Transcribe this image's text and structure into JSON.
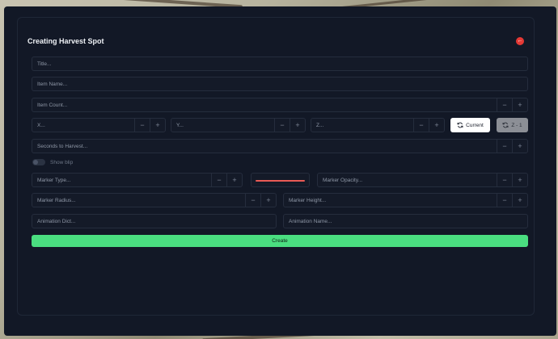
{
  "form": {
    "title": "Creating Harvest Spot",
    "close_icon": "arrow-left-icon",
    "close_color": "#e53935",
    "title_placeholder": "Title...",
    "item_name_placeholder": "Item Name...",
    "item_count_placeholder": "Item Count...",
    "x_placeholder": "X...",
    "y_placeholder": "Y...",
    "z_placeholder": "Z...",
    "current_label": "Current",
    "z_offset_label": "Z - 1",
    "seconds_placeholder": "Seconds to Harvest...",
    "show_blip_label": "Show blip",
    "show_blip_on": false,
    "marker_type_placeholder": "Marker Type...",
    "marker_color": "#ea5a55",
    "marker_opacity_placeholder": "Marker Opacity...",
    "marker_radius_placeholder": "Marker Radius...",
    "marker_height_placeholder": "Marker Height...",
    "animation_dict_placeholder": "Animation Dict...",
    "animation_name_placeholder": "Animation Name...",
    "create_label": "Create",
    "create_color": "#4ade80",
    "minus_glyph": "−",
    "plus_glyph": "+"
  }
}
